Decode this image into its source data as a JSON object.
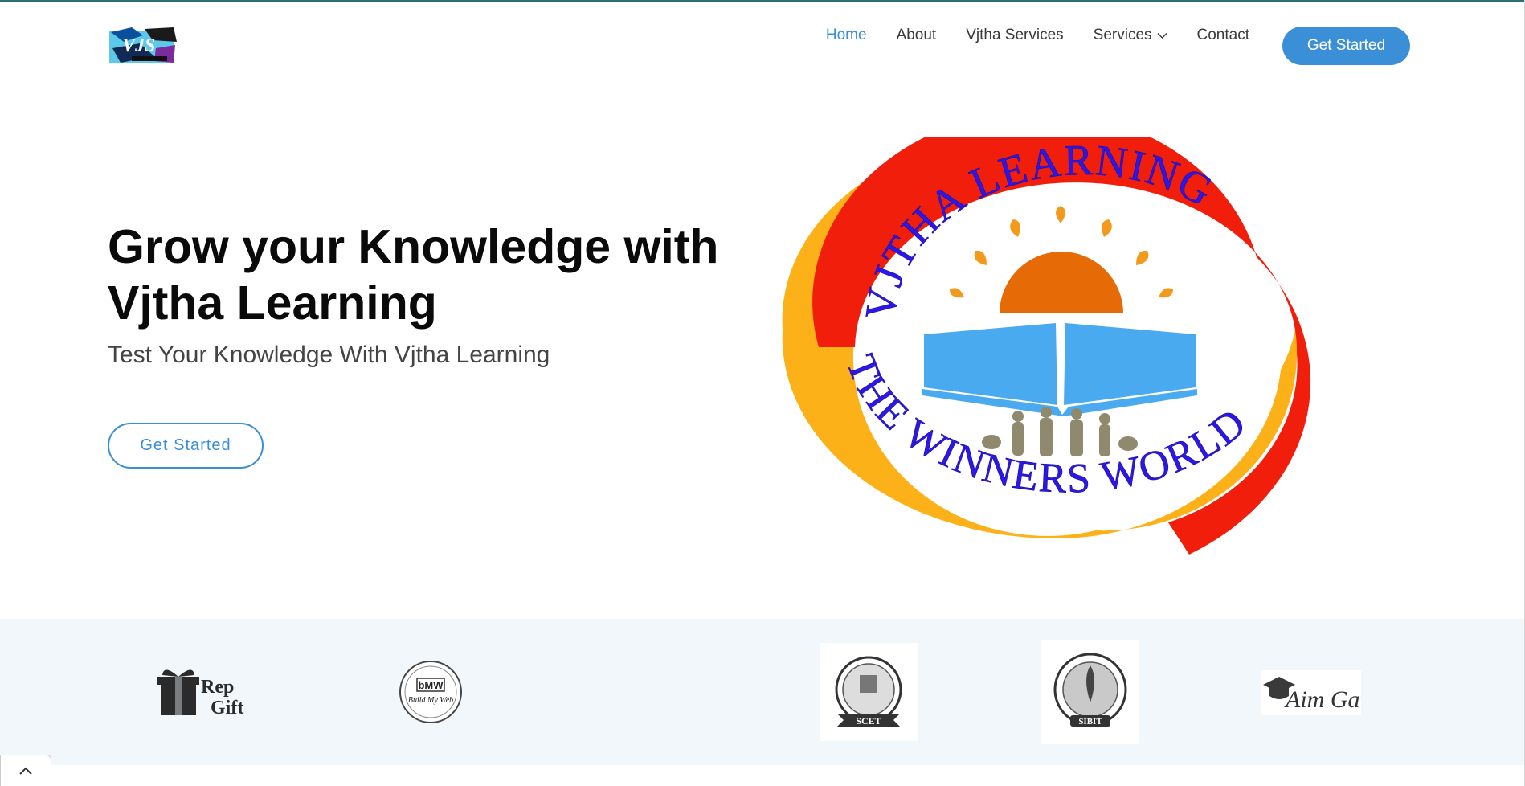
{
  "header": {
    "logo_icon": "vjtha-logo-icon",
    "nav": [
      {
        "label": "Home",
        "active": true
      },
      {
        "label": "About"
      },
      {
        "label": "Vjtha Services"
      },
      {
        "label": "Services",
        "has_dropdown": true
      },
      {
        "label": "Contact"
      }
    ],
    "cta_label": "Get Started"
  },
  "hero": {
    "title_line1": "Grow your Knowledge with",
    "title_line2": "Vjtha Learning",
    "subtitle": "Test Your Knowledge With Vjtha Learning",
    "cta_label": "Get Started",
    "emblem": {
      "top_text": "VJTHA LEARNING",
      "bottom_text": "THE WINNERS WORLD"
    }
  },
  "clients": [
    {
      "icon": "gift-logo-icon",
      "text": "Rep Gift"
    },
    {
      "icon": "bmw-build-my-web-logo-icon",
      "text": "bMW",
      "subtext": "Build My Web"
    },
    {
      "icon": "scet-seal-icon",
      "text": "SCET"
    },
    {
      "icon": "sibit-seal-icon",
      "text": "SIBIT"
    },
    {
      "icon": "aim-gate-logo-icon",
      "text": "Aim Gate"
    }
  ],
  "colors": {
    "accent": "#3b8fd6",
    "band": "#f2f7fb",
    "emblem_red": "#f21e0c",
    "emblem_yellow": "#fbb117",
    "emblem_text": "#2c17e6",
    "emblem_sun": "#e66a06",
    "emblem_book": "#4aaaf0"
  }
}
